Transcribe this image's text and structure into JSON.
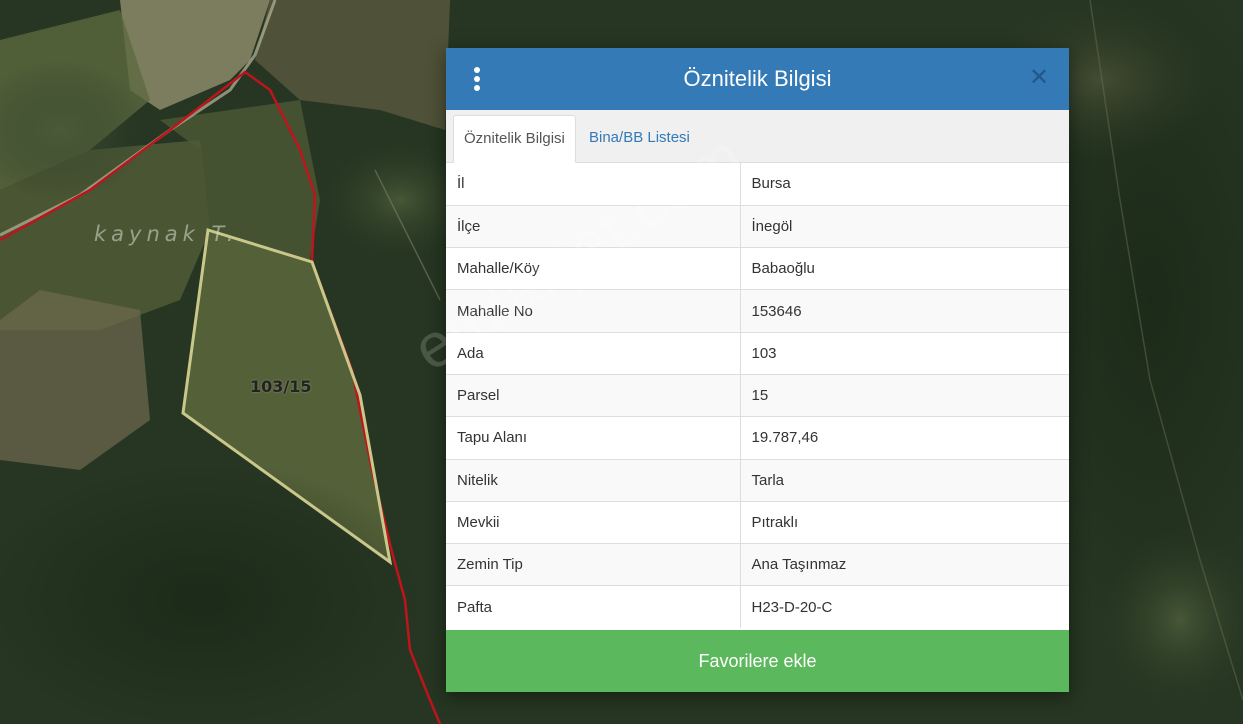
{
  "map": {
    "place_label": "kaynak T.",
    "parcel_label": "103/15",
    "watermark": "emlakjet.com"
  },
  "modal": {
    "title": "Öznitelik Bilgisi",
    "tabs": [
      {
        "label": "Öznitelik Bilgisi",
        "active": true
      },
      {
        "label": "Bina/BB Listesi",
        "active": false
      }
    ],
    "rows": [
      {
        "key": "İl",
        "value": "Bursa"
      },
      {
        "key": "İlçe",
        "value": "İnegöl"
      },
      {
        "key": "Mahalle/Köy",
        "value": "Babaoğlu"
      },
      {
        "key": "Mahalle No",
        "value": "153646"
      },
      {
        "key": "Ada",
        "value": "103"
      },
      {
        "key": "Parsel",
        "value": "15"
      },
      {
        "key": "Tapu Alanı",
        "value": "19.787,46"
      },
      {
        "key": "Nitelik",
        "value": "Tarla"
      },
      {
        "key": "Mevkii",
        "value": "Pıtraklı"
      },
      {
        "key": "Zemin Tip",
        "value": "Ana Taşınmaz"
      },
      {
        "key": "Pafta",
        "value": "H23-D-20-C"
      }
    ],
    "favorite_button": "Favorilere ekle",
    "close_icon": "close-icon",
    "menu_icon": "vertical-dots-icon"
  },
  "colors": {
    "header": "#337ab7",
    "favorite": "#5cb85c",
    "parcel_outline": "#c9c78a",
    "boundary_line": "#c0141c"
  }
}
